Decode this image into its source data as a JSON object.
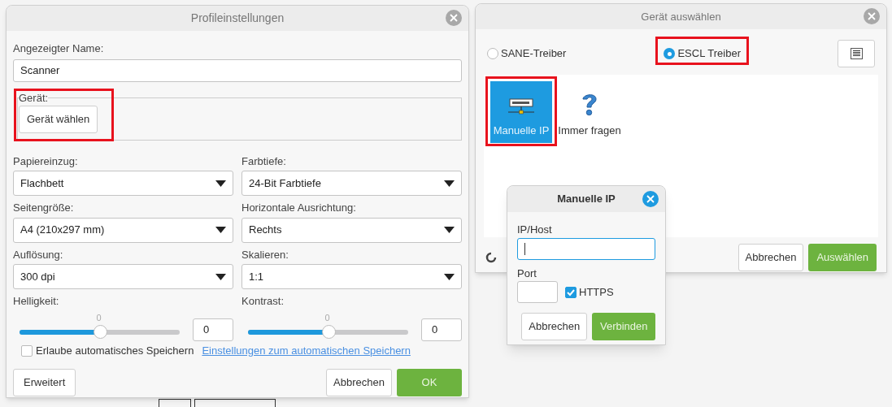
{
  "profile_dialog": {
    "title": "Profileinstellungen",
    "name_label": "Angezeigter Name:",
    "name_value": "Scanner",
    "device_group": "Gerät:",
    "device_button": "Gerät wählen",
    "selects": [
      {
        "label": "Papiereinzug:",
        "value": "Flachbett"
      },
      {
        "label": "Farbtiefe:",
        "value": "24-Bit Farbtiefe"
      },
      {
        "label": "Seitengröße:",
        "value": "A4 (210x297 mm)"
      },
      {
        "label": "Horizontale Ausrichtung:",
        "value": "Rechts"
      },
      {
        "label": "Auflösung:",
        "value": "300 dpi"
      },
      {
        "label": "Skalieren:",
        "value": "1:1"
      }
    ],
    "sliders": [
      {
        "label": "Helligkeit:",
        "reading": "0",
        "level": 0.5,
        "value": "0"
      },
      {
        "label": "Kontrast:",
        "reading": "0",
        "level": 0.5,
        "value": "0"
      }
    ],
    "autosave": {
      "label": "Erlaube automatisches Speichern",
      "checked": false
    },
    "autosave_link": "Einstellungen zum automatischen Speichern",
    "buttons": {
      "advanced": "Erweitert",
      "cancel": "Abbrechen",
      "ok": "OK"
    }
  },
  "device_dialog": {
    "title": "Gerät auswählen",
    "drivers": [
      {
        "label": "SANE-Treiber",
        "selected": false
      },
      {
        "label": "ESCL Treiber",
        "selected": true
      }
    ],
    "devices": [
      {
        "kind": "network",
        "label": "Manuelle IP",
        "selected": true
      },
      {
        "kind": "question",
        "label": "Immer fragen",
        "selected": false
      }
    ],
    "buttons": {
      "cancel": "Abbrechen",
      "select": "Auswählen"
    }
  },
  "ip_dialog": {
    "title": "Manuelle IP",
    "host_label": "IP/Host",
    "port_label": "Port",
    "https": {
      "label": "HTTPS",
      "checked": true
    },
    "buttons": {
      "cancel": "Abbrechen",
      "connect": "Verbinden"
    }
  }
}
